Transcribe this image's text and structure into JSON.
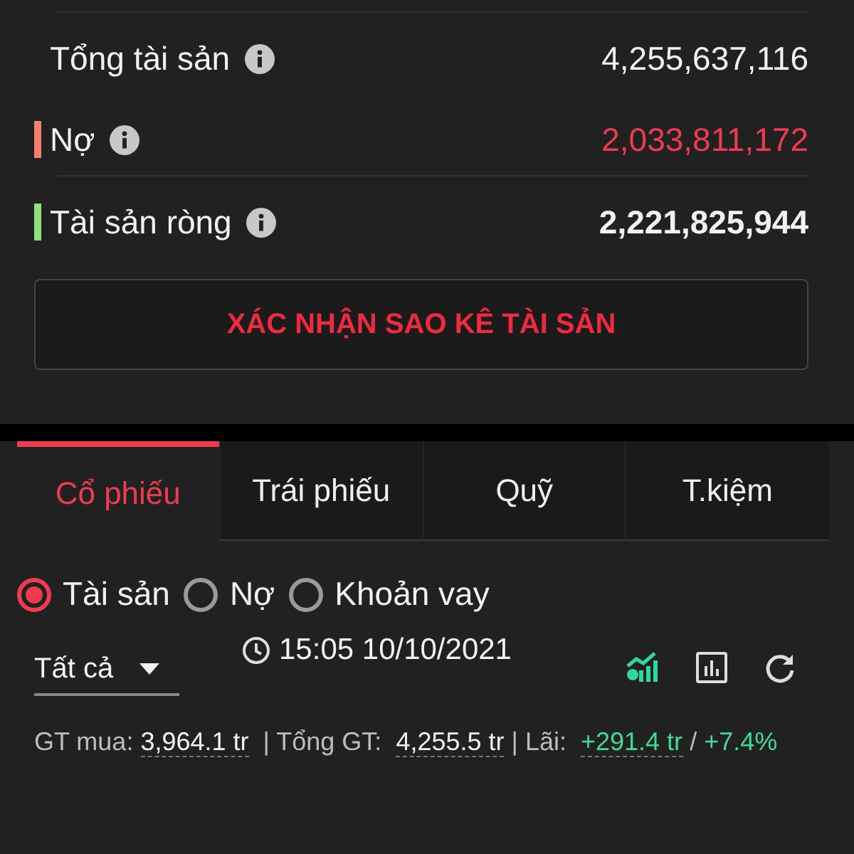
{
  "summary": [
    {
      "label": "Tổng tài sản",
      "value": "4,255,637,116",
      "kind": "plain"
    },
    {
      "label": "Nợ",
      "value": "2,033,811,172",
      "kind": "negative",
      "color": "#f0826e"
    },
    {
      "label": "Tài sản ròng",
      "value": "2,221,825,944",
      "kind": "strong",
      "color": "#8fe07f"
    }
  ],
  "confirm_button": "XÁC NHẬN SAO KÊ TÀI SẢN",
  "tabs": [
    {
      "label": "Cổ phiếu",
      "selected": true
    },
    {
      "label": "Trái phiếu",
      "selected": false
    },
    {
      "label": "Quỹ",
      "selected": false
    },
    {
      "label": "T.kiệm",
      "selected": false
    }
  ],
  "radios": [
    {
      "label": "Tài sản",
      "selected": true
    },
    {
      "label": "Nợ",
      "selected": false
    },
    {
      "label": "Khoản vay",
      "selected": false
    }
  ],
  "filter": {
    "value": "Tất cả"
  },
  "timestamp": "15:05 10/10/2021",
  "totals": {
    "buy_label": "GT mua:",
    "buy_value": "3,964.1 tr",
    "total_label": "| Tổng GT:",
    "total_value": "4,255.5 tr",
    "profit_label": "| Lãi:",
    "profit_value": "+291.4 tr",
    "separator": "/",
    "profit_percent": "+7.4%"
  }
}
